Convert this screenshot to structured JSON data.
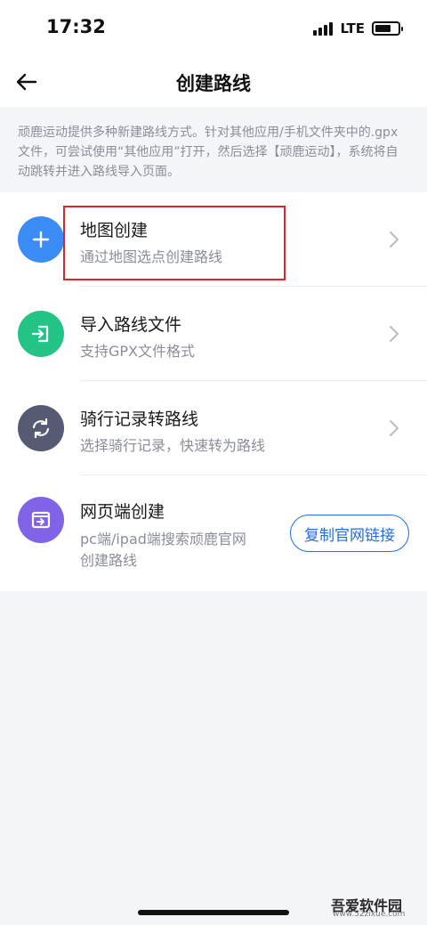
{
  "status": {
    "time": "17:32",
    "network": "LTE"
  },
  "nav": {
    "title": "创建路线",
    "back_icon": "arrow-left-icon"
  },
  "info_text": "顽鹿运动提供多种新建路线方式。针对其他应用/手机文件夹中的.gpx文件，可尝试使用“其他应用”打开，然后选择【顽鹿运动】，系统将自动跳转并进入路线导入页面。",
  "options": [
    {
      "title": "地图创建",
      "subtitle": "通过地图选点创建路线",
      "icon": "plus-icon",
      "color": "#3b8cf5"
    },
    {
      "title": "导入路线文件",
      "subtitle": "支持GPX文件格式",
      "icon": "import-icon",
      "color": "#24c486"
    },
    {
      "title": "骑行记录转路线",
      "subtitle": "选择骑行记录，快速转为路线",
      "icon": "convert-icon",
      "color": "#565a73"
    },
    {
      "title": "网页端创建",
      "subtitle_line1": "pc端/ipad端搜索顽鹿官网",
      "subtitle_line2": "创建路线",
      "icon": "web-import-icon",
      "color": "#8063e6",
      "button_label": "复制官网链接"
    }
  ],
  "colors": {
    "accent": "#1f6fe0",
    "highlight": "#d9262c"
  },
  "watermark": {
    "text": "吾爱软件园",
    "url": "www.52zixue.com"
  }
}
